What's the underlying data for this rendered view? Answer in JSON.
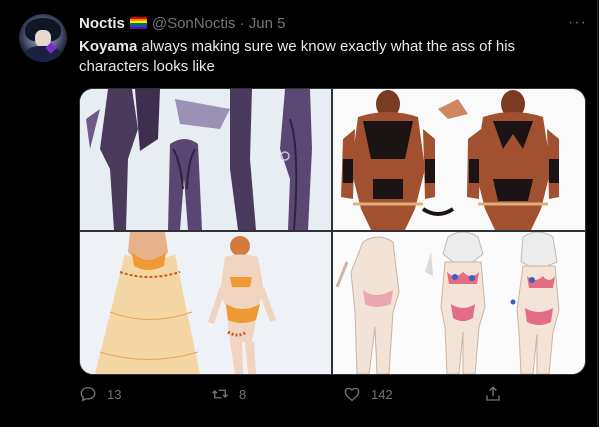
{
  "tweet": {
    "author_name": "Noctis",
    "handle": "@SonNoctis",
    "separator": "·",
    "date": "Jun 5",
    "more_label": "···",
    "text_bold": "Koyama",
    "text_rest": " always making sure we know exactly what the ass of his characters looks like"
  },
  "media": {
    "images": [
      "purple suit character reference",
      "dark-skinned armored character reference",
      "orange outfit with sheer skirt reference",
      "bikini character reference sketch"
    ]
  },
  "actions": {
    "reply_count": "13",
    "retweet_count": "8",
    "like_count": "142"
  },
  "icons": {
    "reply": "reply-icon",
    "retweet": "retweet-icon",
    "like": "heart-icon",
    "share": "share-icon",
    "flag": "rainbow-flag-icon"
  },
  "colors": {
    "background": "#000000",
    "text": "#e7e9ea",
    "muted": "#71767b",
    "border": "#2f3336"
  }
}
